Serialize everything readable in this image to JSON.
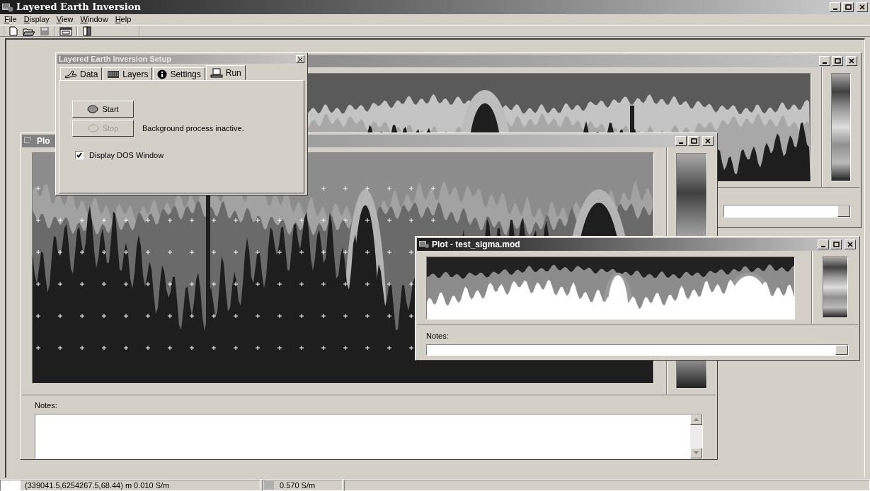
{
  "app": {
    "title": "Layered Earth Inversion"
  },
  "menu": [
    {
      "label": "File"
    },
    {
      "label": "Display"
    },
    {
      "label": "View"
    },
    {
      "label": "Window"
    },
    {
      "label": "Help"
    }
  ],
  "setup_dialog": {
    "title": "Layered Earth Inversion Setup",
    "tabs": [
      {
        "label": "Data",
        "selected": false
      },
      {
        "label": "Layers",
        "selected": false
      },
      {
        "label": "Settings",
        "selected": false
      },
      {
        "label": "Run",
        "selected": true
      }
    ],
    "start_button": {
      "label": "Start",
      "disabled": false
    },
    "stop_button": {
      "label": "Stop",
      "disabled": true
    },
    "process_status": "Background process inactive.",
    "dos_window": {
      "label": "Display DOS Window",
      "checked": true
    }
  },
  "plot_window": {
    "title": "Plo",
    "notes_label": "Notes:"
  },
  "sigma_window": {
    "title": "Plot - test_sigma.mod",
    "notes_label": "Notes:"
  },
  "status_bar": [
    "(339041.5,6254267.5,68.44) m 0.010 S/m",
    "0.570 S/m"
  ]
}
